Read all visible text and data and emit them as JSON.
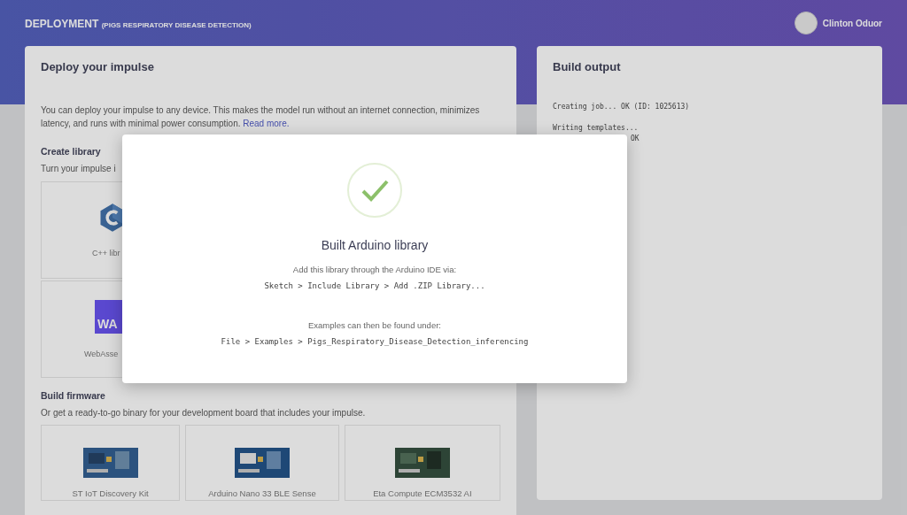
{
  "header": {
    "title": "DEPLOYMENT",
    "subtitle": "(PIGS RESPIRATORY DISEASE DETECTION)",
    "user": "Clinton Oduor"
  },
  "deploy_card": {
    "title": "Deploy your impulse",
    "description": "You can deploy your impulse to any device. This makes the model run without an internet connection, minimizes latency, and runs with minimal power consumption.",
    "read_more": "Read more.",
    "library": {
      "heading": "Create library",
      "subtitle": "Turn your impulse i",
      "options": [
        {
          "kind": "cpp",
          "label": "C++ libr"
        },
        {
          "kind": "wasm",
          "label": "WebAsse",
          "logo_text": "WA"
        }
      ]
    },
    "firmware": {
      "heading": "Build firmware",
      "subtitle": "Or get a ready-to-go binary for your development board that includes your impulse.",
      "boards": [
        {
          "kind": "picture",
          "label": "ST IoT Discovery Kit"
        },
        {
          "kind": "picture",
          "label": "Arduino Nano 33 BLE Sense"
        },
        {
          "kind": "picture",
          "label": "Eta Compute ECM3532 AI"
        }
      ]
    }
  },
  "build_output": {
    "title": "Build output",
    "log_blocks": [
      {
        "lines": [
          "Creating job... OK (ID: 1025613)"
        ]
      },
      {
        "lines": [
          "Writing templates..."
        ],
        "tail": "OK"
      }
    ]
  },
  "dialog": {
    "title": "Built Arduino library",
    "instruction": "Add this library through the Arduino IDE via:",
    "install_path": "Sketch > Include Library > Add .ZIP Library...",
    "note": "Examples can then be found under:",
    "examples_path": "File > Examples > Pigs_Respiratory_Disease_Detection_inferencing"
  }
}
